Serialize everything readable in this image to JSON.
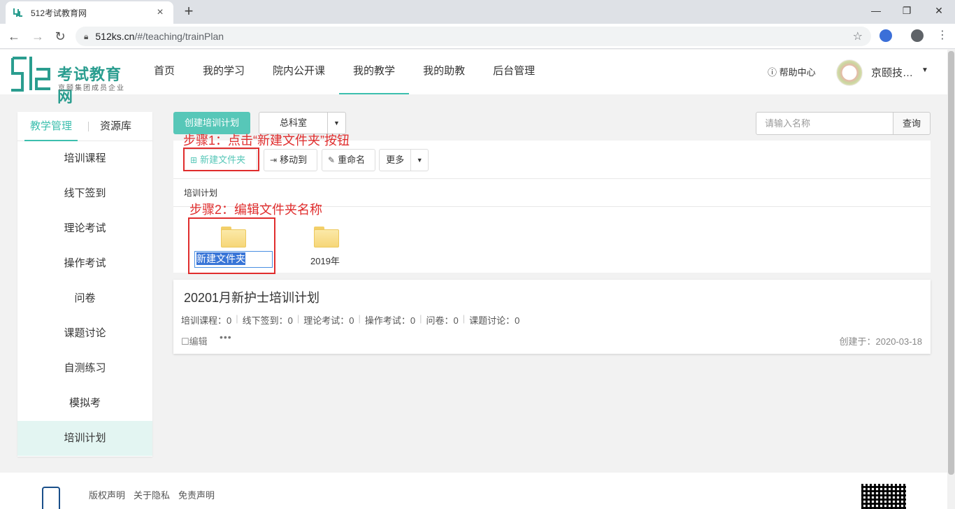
{
  "browser": {
    "tab_title": "512考试教育网",
    "url_host": "512ks.cn",
    "url_path": "/#/teaching/trainPlan"
  },
  "site": {
    "logo_text": "考试教育网",
    "logo_sub": "京颐集团成员企业",
    "nav": [
      "首页",
      "我的学习",
      "院内公开课",
      "我的教学",
      "我的助教",
      "后台管理"
    ],
    "nav_active": "我的教学",
    "help": "帮助中心",
    "username": "京颐技…"
  },
  "sidebar": {
    "tabs": [
      "教学管理",
      "资源库"
    ],
    "items": [
      "培训课程",
      "线下签到",
      "理论考试",
      "操作考试",
      "问卷",
      "课题讨论",
      "自测练习",
      "模拟考",
      "培训计划"
    ],
    "active_item": "培训计划"
  },
  "toolbar": {
    "create_label": "创建培训计划",
    "dept_value": "总科室",
    "search_placeholder": "请输入名称",
    "search_button": "查询"
  },
  "file_panel": {
    "buttons": {
      "new_folder": "新建文件夹",
      "move_to": "移动到",
      "rename": "重命名",
      "more": "更多"
    },
    "breadcrumb": "培训计划",
    "new_folder_name": "新建文件夹",
    "folders": [
      "2019年"
    ]
  },
  "plan": {
    "title": "20201月新护士培训计划",
    "stats": [
      "培训课程：0",
      "线下签到：0",
      "理论考试：0",
      "操作考试：0",
      "问卷：0",
      "课题讨论：0"
    ],
    "edit_label": "编辑",
    "more": "•••",
    "created": "创建于：2020-03-18"
  },
  "annotations": {
    "step1": "步骤1：点击“新建文件夹”按钮",
    "step2": "步骤2：编辑文件夹名称"
  },
  "footer": {
    "links": [
      "版权声明",
      "关于隐私",
      "免责声明"
    ]
  },
  "colors": {
    "accent": "#3cbfae",
    "annotation": "#e02d2d"
  }
}
